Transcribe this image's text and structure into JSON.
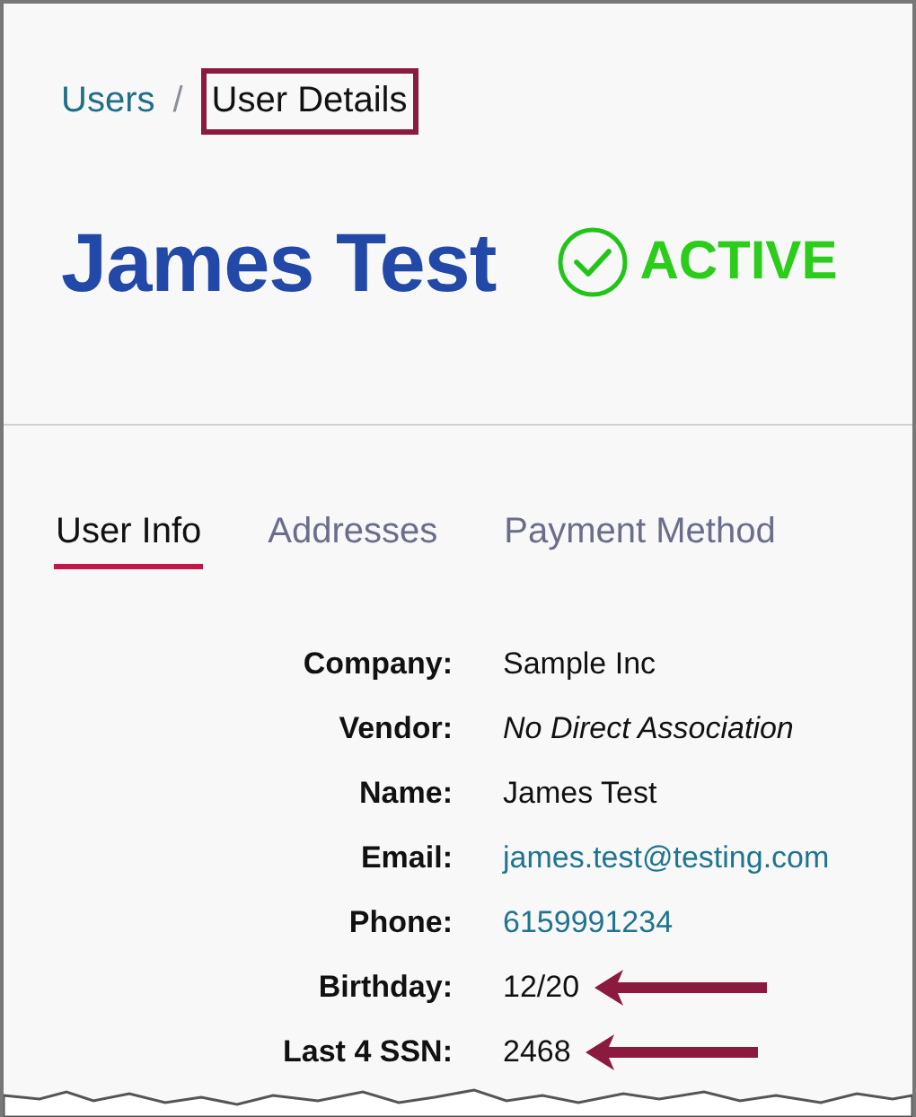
{
  "breadcrumb": [
    {
      "label": "Users",
      "current": false,
      "highlighted": false
    },
    {
      "label": "User Details",
      "current": true,
      "highlighted": true
    }
  ],
  "breadcrumb_separator": "/",
  "user": {
    "name": "James Test",
    "status": {
      "label": "ACTIVE",
      "kind": "active"
    }
  },
  "tabs": [
    {
      "label": "User Info",
      "selected": true
    },
    {
      "label": "Addresses",
      "selected": false
    },
    {
      "label": "Payment Method",
      "selected": false
    }
  ],
  "fields": [
    {
      "label": "Company:",
      "value": "Sample Inc",
      "kind": "text",
      "arrow": false
    },
    {
      "label": "Vendor:",
      "value": "No Direct Association",
      "kind": "italic",
      "arrow": false
    },
    {
      "label": "Name:",
      "value": "James Test",
      "kind": "text",
      "arrow": false
    },
    {
      "label": "Email:",
      "value": "james.test@testing.com",
      "kind": "link",
      "arrow": false
    },
    {
      "label": "Phone:",
      "value": "6159991234",
      "kind": "link",
      "arrow": false
    },
    {
      "label": "Birthday:",
      "value": "12/20",
      "kind": "text",
      "arrow": true
    },
    {
      "label": "Last 4 SSN:",
      "value": "2468",
      "kind": "text",
      "arrow": true
    }
  ]
}
